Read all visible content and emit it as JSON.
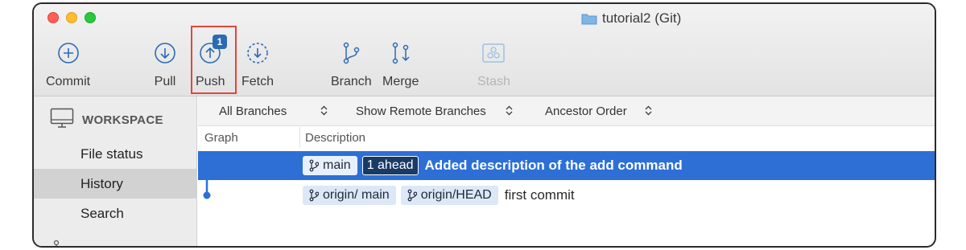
{
  "window": {
    "title": "tutorial2 (Git)"
  },
  "toolbar": {
    "commit": "Commit",
    "pull": "Pull",
    "push": "Push",
    "push_badge": "1",
    "fetch": "Fetch",
    "branch": "Branch",
    "merge": "Merge",
    "stash": "Stash"
  },
  "sidebar": {
    "workspace": "WORKSPACE",
    "items": [
      {
        "label": "File status"
      },
      {
        "label": "History",
        "selected": true
      },
      {
        "label": "Search"
      }
    ]
  },
  "filters": {
    "branches": "All Branches",
    "remote": "Show Remote Branches",
    "order": "Ancestor Order"
  },
  "columns": {
    "graph": "Graph",
    "description": "Description"
  },
  "commits": [
    {
      "refs": [
        {
          "name": "main"
        }
      ],
      "ahead": "1 ahead",
      "message": "Added description of the add command",
      "selected": true
    },
    {
      "refs": [
        {
          "name": "origin/ main"
        },
        {
          "name": "origin/HEAD"
        }
      ],
      "message": "first commit",
      "selected": false
    }
  ],
  "colors": {
    "accent": "#2d6fd5",
    "highlight": "#e0473b",
    "ref_bg": "#dce8f6",
    "ahead_bg": "#1a3a66"
  }
}
